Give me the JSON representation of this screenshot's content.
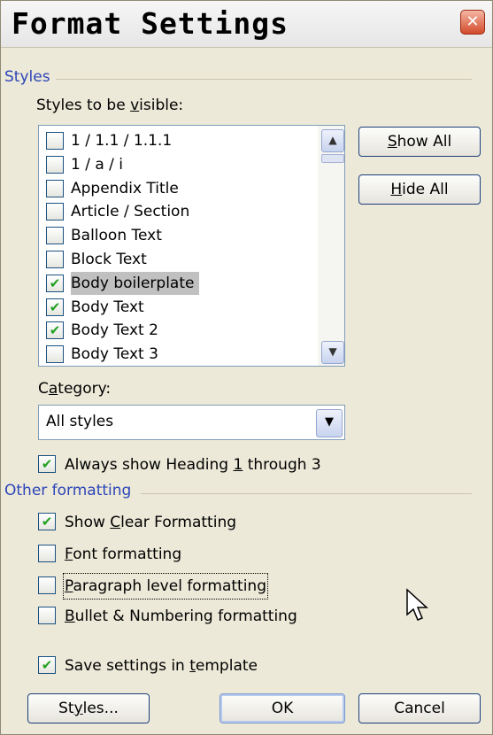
{
  "window": {
    "title": "Format Settings",
    "close_glyph": "✕"
  },
  "styles_section": {
    "label": "Styles",
    "visible_label": "Styles to be visible:",
    "items": [
      {
        "label": "1 / 1.1 / 1.1.1",
        "checked": false,
        "selected": false
      },
      {
        "label": "1 / a / i",
        "checked": false,
        "selected": false
      },
      {
        "label": "Appendix Title",
        "checked": false,
        "selected": false
      },
      {
        "label": "Article / Section",
        "checked": false,
        "selected": false
      },
      {
        "label": "Balloon Text",
        "checked": false,
        "selected": false
      },
      {
        "label": "Block Text",
        "checked": false,
        "selected": false
      },
      {
        "label": "Body boilerplate",
        "checked": true,
        "selected": true
      },
      {
        "label": "Body Text",
        "checked": true,
        "selected": false
      },
      {
        "label": "Body Text 2",
        "checked": true,
        "selected": false
      },
      {
        "label": "Body Text 3",
        "checked": false,
        "selected": false
      }
    ],
    "show_all": "Show All",
    "hide_all": "Hide All",
    "category_label": "Category:",
    "category_value": "All styles",
    "always_show_heading": {
      "label": "Always show Heading 1 through 3",
      "checked": true
    }
  },
  "other_formatting": {
    "label": "Other formatting",
    "options": [
      {
        "label": "Show Clear Formatting",
        "checked": true
      },
      {
        "label": "Font formatting",
        "checked": false
      },
      {
        "label": "Paragraph level formatting",
        "checked": false,
        "focused": true
      },
      {
        "label": "Bullet & Numbering formatting",
        "checked": false
      }
    ]
  },
  "save_settings": {
    "label": "Save settings in template",
    "checked": true
  },
  "footer": {
    "styles_button": "Styles...",
    "ok_button": "OK",
    "cancel_button": "Cancel"
  },
  "icons": {
    "check": "✔",
    "scroll_up": "▲",
    "scroll_down": "▼",
    "dropdown": "▼"
  }
}
